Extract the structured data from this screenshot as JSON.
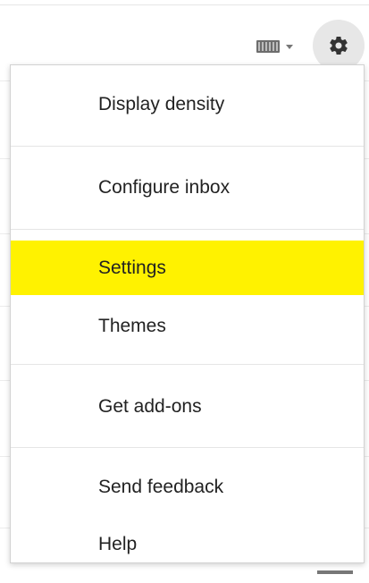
{
  "toolbar": {
    "keyboard_icon": "keyboard-icon",
    "keyboard_caret_icon": "chevron-down-icon",
    "settings_icon": "gear-icon"
  },
  "menu": {
    "items": [
      {
        "label": "Display density"
      },
      {
        "label": "Configure inbox"
      },
      {
        "label": "Settings",
        "highlighted": true
      },
      {
        "label": "Themes"
      },
      {
        "label": "Get add-ons"
      },
      {
        "label": "Send feedback"
      },
      {
        "label": "Help"
      }
    ]
  },
  "colors": {
    "highlight": "#fff200",
    "gear_button_bg": "#e7e7e7",
    "text": "#222222"
  }
}
